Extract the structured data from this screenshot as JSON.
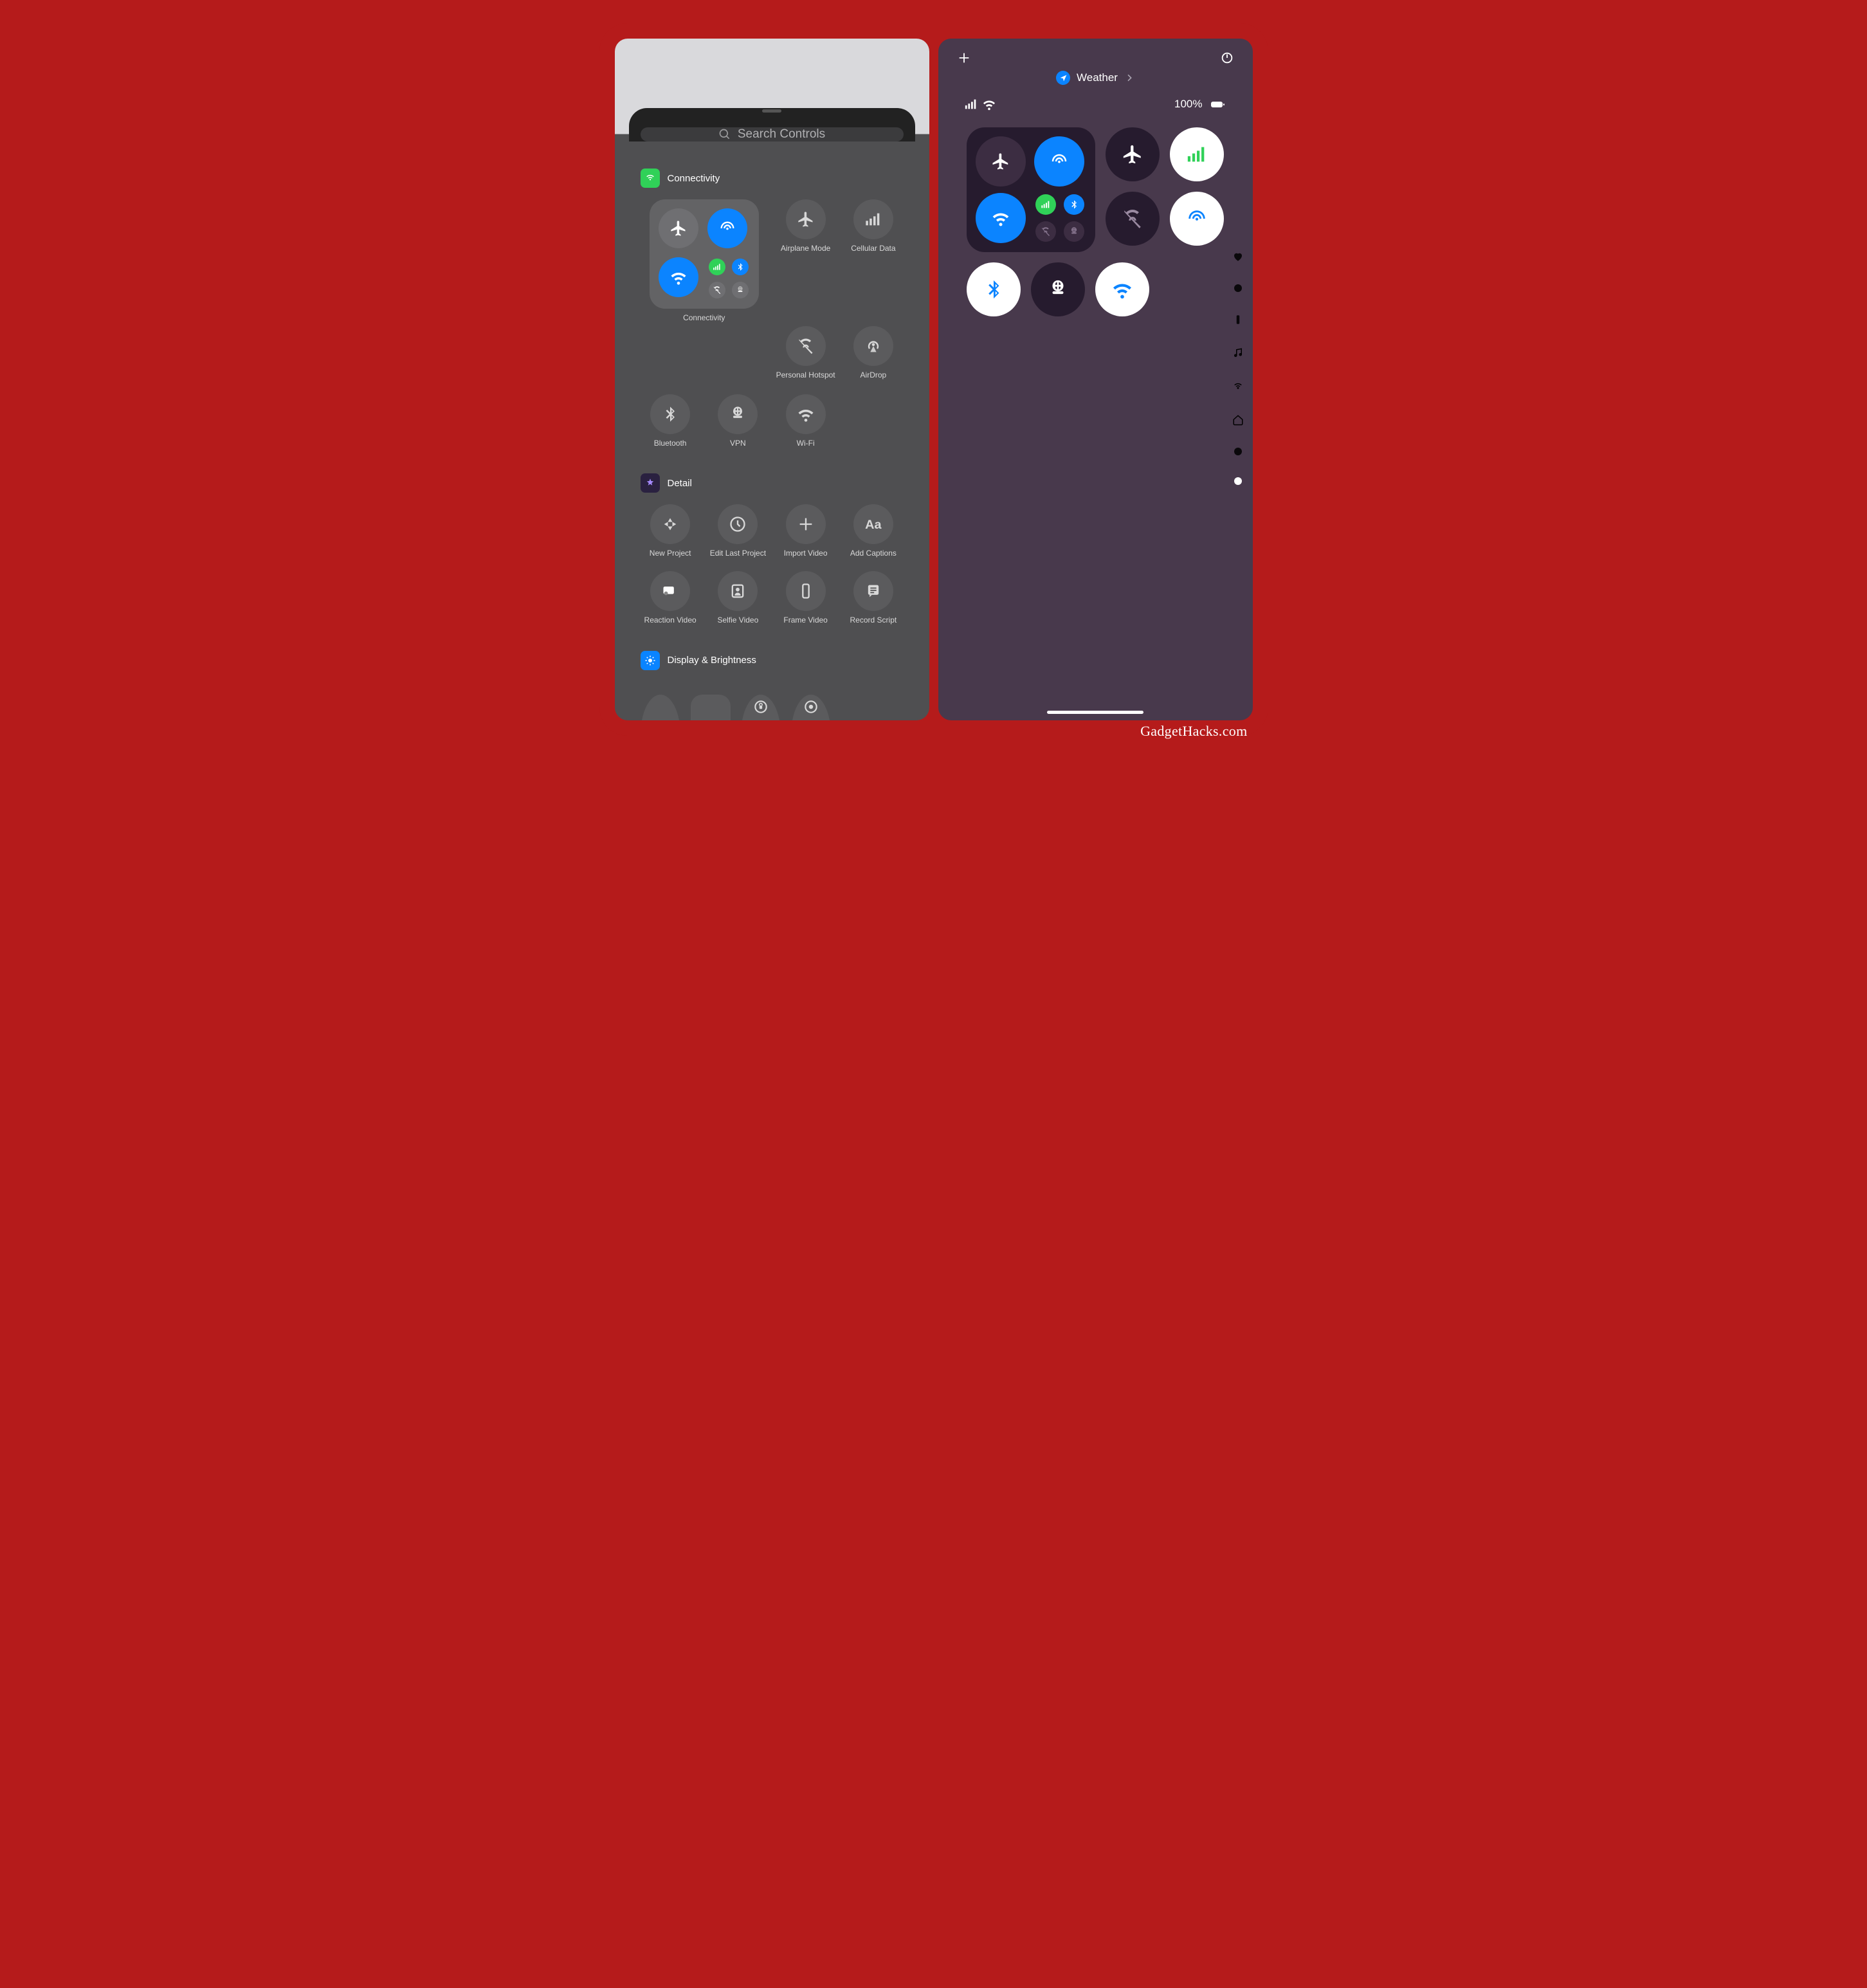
{
  "left": {
    "search_placeholder": "Search Controls",
    "sections": {
      "connectivity": {
        "title": "Connectivity",
        "items": {
          "composite_label": "Connectivity",
          "airplane": "Airplane Mode",
          "cellular": "Cellular Data",
          "hotspot": "Personal Hotspot",
          "airdrop": "AirDrop",
          "bluetooth": "Bluetooth",
          "vpn": "VPN",
          "wifi": "Wi-Fi"
        }
      },
      "detail": {
        "title": "Detail",
        "items": {
          "new_project": "New Project",
          "edit_last": "Edit Last Project",
          "import_video": "Import Video",
          "add_captions": "Add Captions",
          "reaction_video": "Reaction Video",
          "selfie_video": "Selfie Video",
          "frame_video": "Frame Video",
          "record_script": "Record Script"
        }
      },
      "display": {
        "title": "Display & Brightness"
      }
    }
  },
  "right": {
    "focus_label": "Weather",
    "battery_pct": "100%"
  },
  "watermark": "GadgetHacks.com"
}
